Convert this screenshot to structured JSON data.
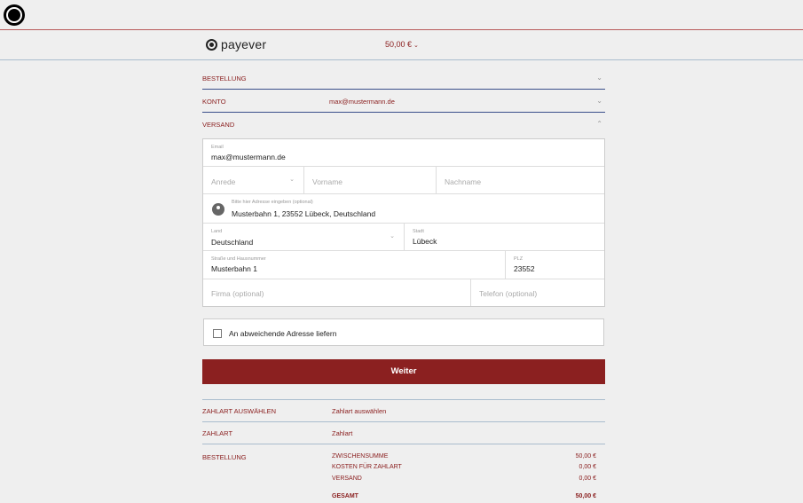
{
  "header": {
    "brand": "payever",
    "amount": "50,00 €"
  },
  "sections": {
    "bestellung": "BESTELLUNG",
    "konto": "KONTO",
    "konto_value": "max@mustermann.de",
    "versand": "VERSAND"
  },
  "form": {
    "email_label": "Email",
    "email_value": "max@mustermann.de",
    "anrede_placeholder": "Anrede",
    "vorname_placeholder": "Vorname",
    "nachname_placeholder": "Nachname",
    "address_label": "Bitte hier Adresse eingeben (optional)",
    "address_value": "Musterbahn 1, 23552 Lübeck, Deutschland",
    "land_label": "Land",
    "land_value": "Deutschland",
    "stadt_label": "Stadt",
    "stadt_value": "Lübeck",
    "strasse_label": "Straße und Hausnummer",
    "strasse_value": "Musterbahn 1",
    "plz_label": "PLZ",
    "plz_value": "23552",
    "firma_placeholder": "Firma (optional)",
    "telefon_placeholder": "Telefon (optional)"
  },
  "alt_address": {
    "label": "An abweichende Adresse liefern"
  },
  "weiter_button": "Weiter",
  "summary": {
    "zahlart_auswaehlen_label": "ZAHLART AUSWÄHLEN",
    "zahlart_auswaehlen_value": "Zahlart auswählen",
    "zahlart_label": "ZAHLART",
    "zahlart_value": "Zahlart",
    "bestellung_label": "BESTELLUNG",
    "items": [
      {
        "label": "Zwischensumme",
        "amount": "50,00 €"
      },
      {
        "label": "Kosten für Zahlart",
        "amount": "0,00 €"
      },
      {
        "label": "Versand",
        "amount": "0,00 €"
      },
      {
        "label": "Gesamt",
        "amount": "50,00 €"
      }
    ]
  },
  "colors": {
    "accent": "#8b2020",
    "divider": "#3a4f8a",
    "background": "#efefef"
  }
}
